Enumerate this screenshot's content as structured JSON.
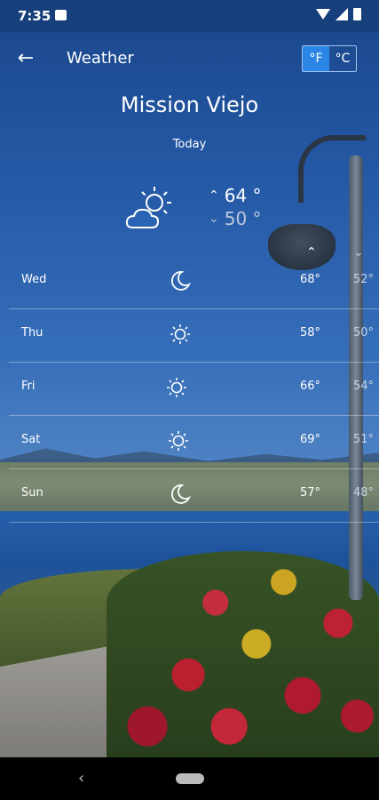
{
  "status": {
    "time": "7:35"
  },
  "header": {
    "title": "Weather",
    "units": [
      "°F",
      "°C"
    ],
    "active_unit": "°F"
  },
  "location": "Mission Viejo",
  "today": {
    "label": "Today",
    "high": "64 °",
    "low": "50 °",
    "icon": "partly-cloudy-icon"
  },
  "forecast": [
    {
      "day": "Wed",
      "icon": "moon-icon",
      "high": "68°",
      "low": "52°"
    },
    {
      "day": "Thu",
      "icon": "sun-icon",
      "high": "58°",
      "low": "50°"
    },
    {
      "day": "Fri",
      "icon": "sun-icon",
      "high": "66°",
      "low": "54°"
    },
    {
      "day": "Sat",
      "icon": "sun-icon",
      "high": "69°",
      "low": "51°"
    },
    {
      "day": "Sun",
      "icon": "moon-icon",
      "high": "57°",
      "low": "48°"
    }
  ]
}
